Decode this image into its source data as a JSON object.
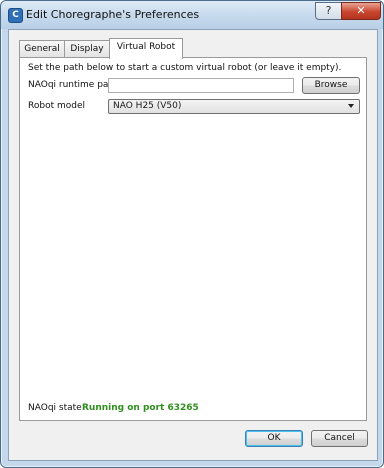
{
  "window": {
    "title": "Edit Choregraphe's Preferences",
    "app_icon_letter": "C",
    "help_label": "?",
    "close_label": "✕"
  },
  "tabs": [
    {
      "label": "General",
      "active": false
    },
    {
      "label": "Display",
      "active": false
    },
    {
      "label": "Virtual Robot",
      "active": true
    }
  ],
  "panel": {
    "info_text": "Set the path below to start a custom virtual robot (or leave it empty).",
    "runtime_path": {
      "label": "NAOqi runtime path",
      "value": "",
      "browse_label": "Browse"
    },
    "robot_model": {
      "label": "Robot model",
      "selected": "NAO H25 (V50)"
    },
    "naoqi_state": {
      "label": "NAOqi state:",
      "value": "Running on port 63265",
      "value_color": "#2f8f1f"
    }
  },
  "footer": {
    "ok_label": "OK",
    "cancel_label": "Cancel"
  }
}
